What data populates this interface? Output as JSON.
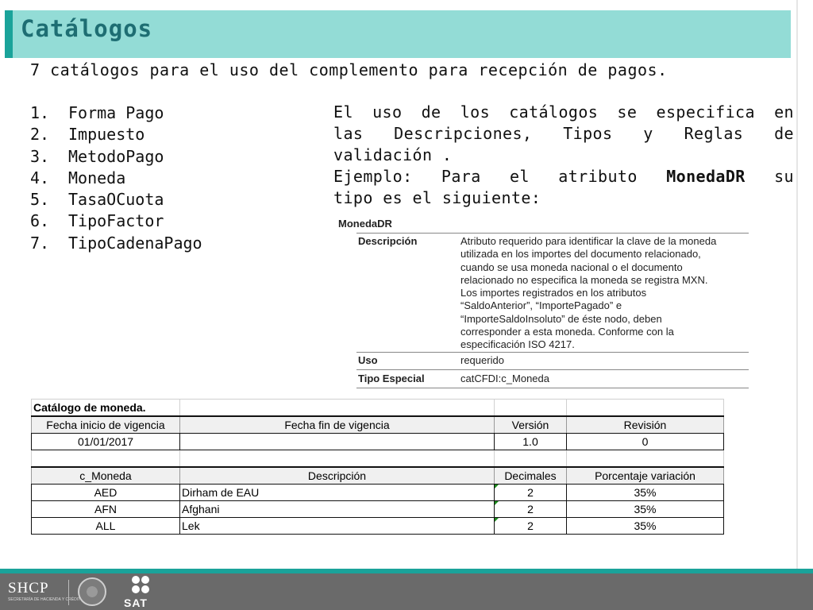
{
  "title": "Catálogos",
  "intro": "7 catálogos para el uso del complemento para recepción de pagos.",
  "catalogs": [
    {
      "num": "1.",
      "name": "Forma Pago"
    },
    {
      "num": "2.",
      "name": "Impuesto"
    },
    {
      "num": "3.",
      "name": "MetodoPago"
    },
    {
      "num": "4.",
      "name": "Moneda"
    },
    {
      "num": "5.",
      "name": "TasaOCuota"
    },
    {
      "num": "6.",
      "name": "TipoFactor"
    },
    {
      "num": "7.",
      "name": "TipoCadenaPago"
    }
  ],
  "explanation": {
    "line1": "El uso de los catálogos  se especifica en",
    "line2": "las Descripciones, Tipos y Reglas de",
    "line3": "validación .",
    "example_prefix": "Ejemplo:   Para  el atributo",
    "example_attr": "MonedaDR",
    "example_suffix": "su",
    "line5": "tipo es el siguiente:"
  },
  "spec": {
    "name": "MonedaDR",
    "description_label": "Descripción",
    "description_lines": [
      "Atributo requerido para identificar la clave de la moneda",
      "utilizada en los importes del documento relacionado,",
      "cuando se usa moneda nacional o el documento",
      "relacionado no especifica la moneda se registra MXN.",
      "Los importes registrados en los atributos",
      "“SaldoAnterior”, “ImportePagado” e",
      "“ImporteSaldoInsoluto” de éste nodo, deben",
      "corresponder a esta moneda. Conforme con la",
      "especificación ISO 4217."
    ],
    "uso_label": "Uso",
    "uso_value": "requerido",
    "tipo_label": "Tipo Especial",
    "tipo_value": "catCFDI:c_Moneda"
  },
  "catalog_table": {
    "title": "Catálogo de moneda.",
    "meta_headers": [
      "Fecha inicio de vigencia",
      "Fecha fin de vigencia",
      "Versión",
      "Revisión"
    ],
    "meta_values": [
      "01/01/2017",
      "",
      "1.0",
      "0"
    ],
    "headers": [
      "c_Moneda",
      "Descripción",
      "Decimales",
      "Porcentaje variación"
    ],
    "rows": [
      [
        "AED",
        "Dirham de EAU",
        "2",
        "35%"
      ],
      [
        "AFN",
        "Afghani",
        "2",
        "35%"
      ],
      [
        "ALL",
        "Lek",
        "2",
        "35%"
      ]
    ]
  },
  "footer": {
    "shcp": "SHCP",
    "shcp_sub": "SECRETARÍA DE HACIENDA Y CRÉDITO PÚBLICO",
    "sat": "SAT"
  }
}
